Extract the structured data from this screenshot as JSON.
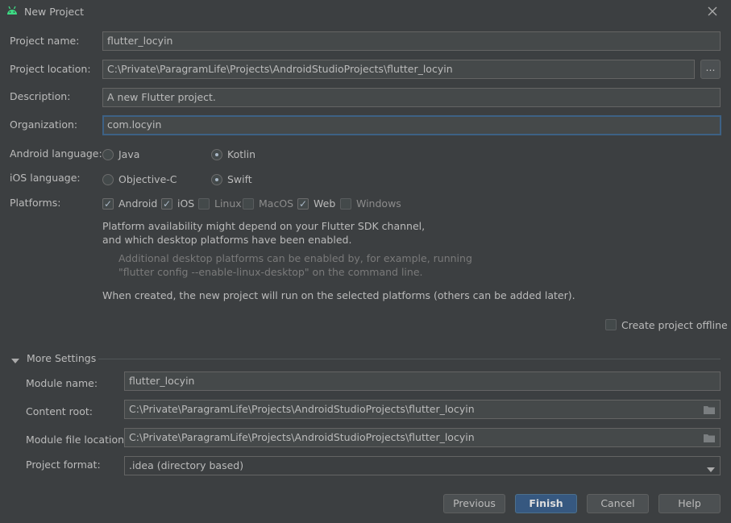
{
  "window": {
    "title": "New Project",
    "close_icon": "close-icon",
    "app_icon": "android-icon"
  },
  "form": {
    "project_name": {
      "label": "Project name:",
      "value": "flutter_locyin"
    },
    "project_location": {
      "label": "Project location:",
      "value": "C:\\Private\\ParagramLife\\Projects\\AndroidStudioProjects\\flutter_locyin",
      "browse_label": "..."
    },
    "description": {
      "label": "Description:",
      "value": "A new Flutter project."
    },
    "organization": {
      "label": "Organization:",
      "value": "com.locyin"
    },
    "android_language": {
      "label": "Android language:",
      "options": [
        "Java",
        "Kotlin"
      ],
      "selected": "Kotlin"
    },
    "ios_language": {
      "label": "iOS language:",
      "options": [
        "Objective-C",
        "Swift"
      ],
      "selected": "Swift"
    },
    "platforms": {
      "label": "Platforms:",
      "items": [
        {
          "name": "Android",
          "checked": true
        },
        {
          "name": "iOS",
          "checked": true
        },
        {
          "name": "Linux",
          "checked": false
        },
        {
          "name": "MacOS",
          "checked": false
        },
        {
          "name": "Web",
          "checked": true
        },
        {
          "name": "Windows",
          "checked": false
        }
      ]
    },
    "info": {
      "line1": "Platform availability might depend on your Flutter SDK channel,",
      "line2": "and which desktop platforms have been enabled.",
      "hint1": "Additional desktop platforms can be enabled by, for example, running",
      "hint2": "\"flutter config --enable-linux-desktop\" on the command line.",
      "note": "When created, the new project will run on the selected platforms (others can be added later)."
    },
    "create_offline": {
      "label": "Create project offline",
      "checked": false
    }
  },
  "more_settings": {
    "title": "More Settings",
    "module_name": {
      "label": "Module name:",
      "value": "flutter_locyin"
    },
    "content_root": {
      "label": "Content root:",
      "value": "C:\\Private\\ParagramLife\\Projects\\AndroidStudioProjects\\flutter_locyin"
    },
    "module_file_location": {
      "label": "Module file location:",
      "value": "C:\\Private\\ParagramLife\\Projects\\AndroidStudioProjects\\flutter_locyin"
    },
    "project_format": {
      "label": "Project format:",
      "value": ".idea (directory based)"
    }
  },
  "buttons": {
    "previous": "Previous",
    "finish": "Finish",
    "cancel": "Cancel",
    "help": "Help"
  },
  "colors": {
    "background": "#3c3f41",
    "field": "#45494a",
    "focus_border": "#3d6185",
    "default_button": "#365880"
  }
}
